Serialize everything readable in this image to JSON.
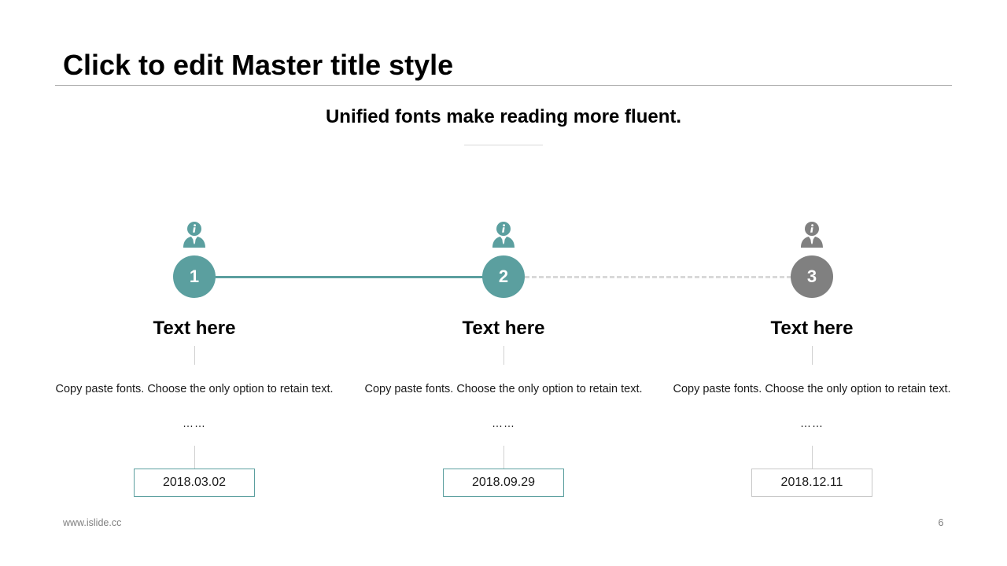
{
  "slide": {
    "title": "Click to edit Master title style",
    "subtitle": "Unified fonts make reading more fluent.",
    "footer_url": "www.islide.cc",
    "page_number": "6"
  },
  "colors": {
    "active": "#5b9f9f",
    "inactive": "#808080",
    "inactive_border": "#c8c8c8"
  },
  "steps": [
    {
      "number": "1",
      "heading": "Text here",
      "description": "Copy paste fonts. Choose the only option to retain text.",
      "ellipsis": "……",
      "date": "2018.03.02",
      "icon": "info-person-icon",
      "status": "active"
    },
    {
      "number": "2",
      "heading": "Text here",
      "description": "Copy paste fonts. Choose the only option to retain text.",
      "ellipsis": "……",
      "date": "2018.09.29",
      "icon": "info-person-icon",
      "status": "active"
    },
    {
      "number": "3",
      "heading": "Text here",
      "description": "Copy paste fonts. Choose the only option to retain text.",
      "ellipsis": "……",
      "date": "2018.12.11",
      "icon": "info-person-icon",
      "status": "inactive"
    }
  ]
}
